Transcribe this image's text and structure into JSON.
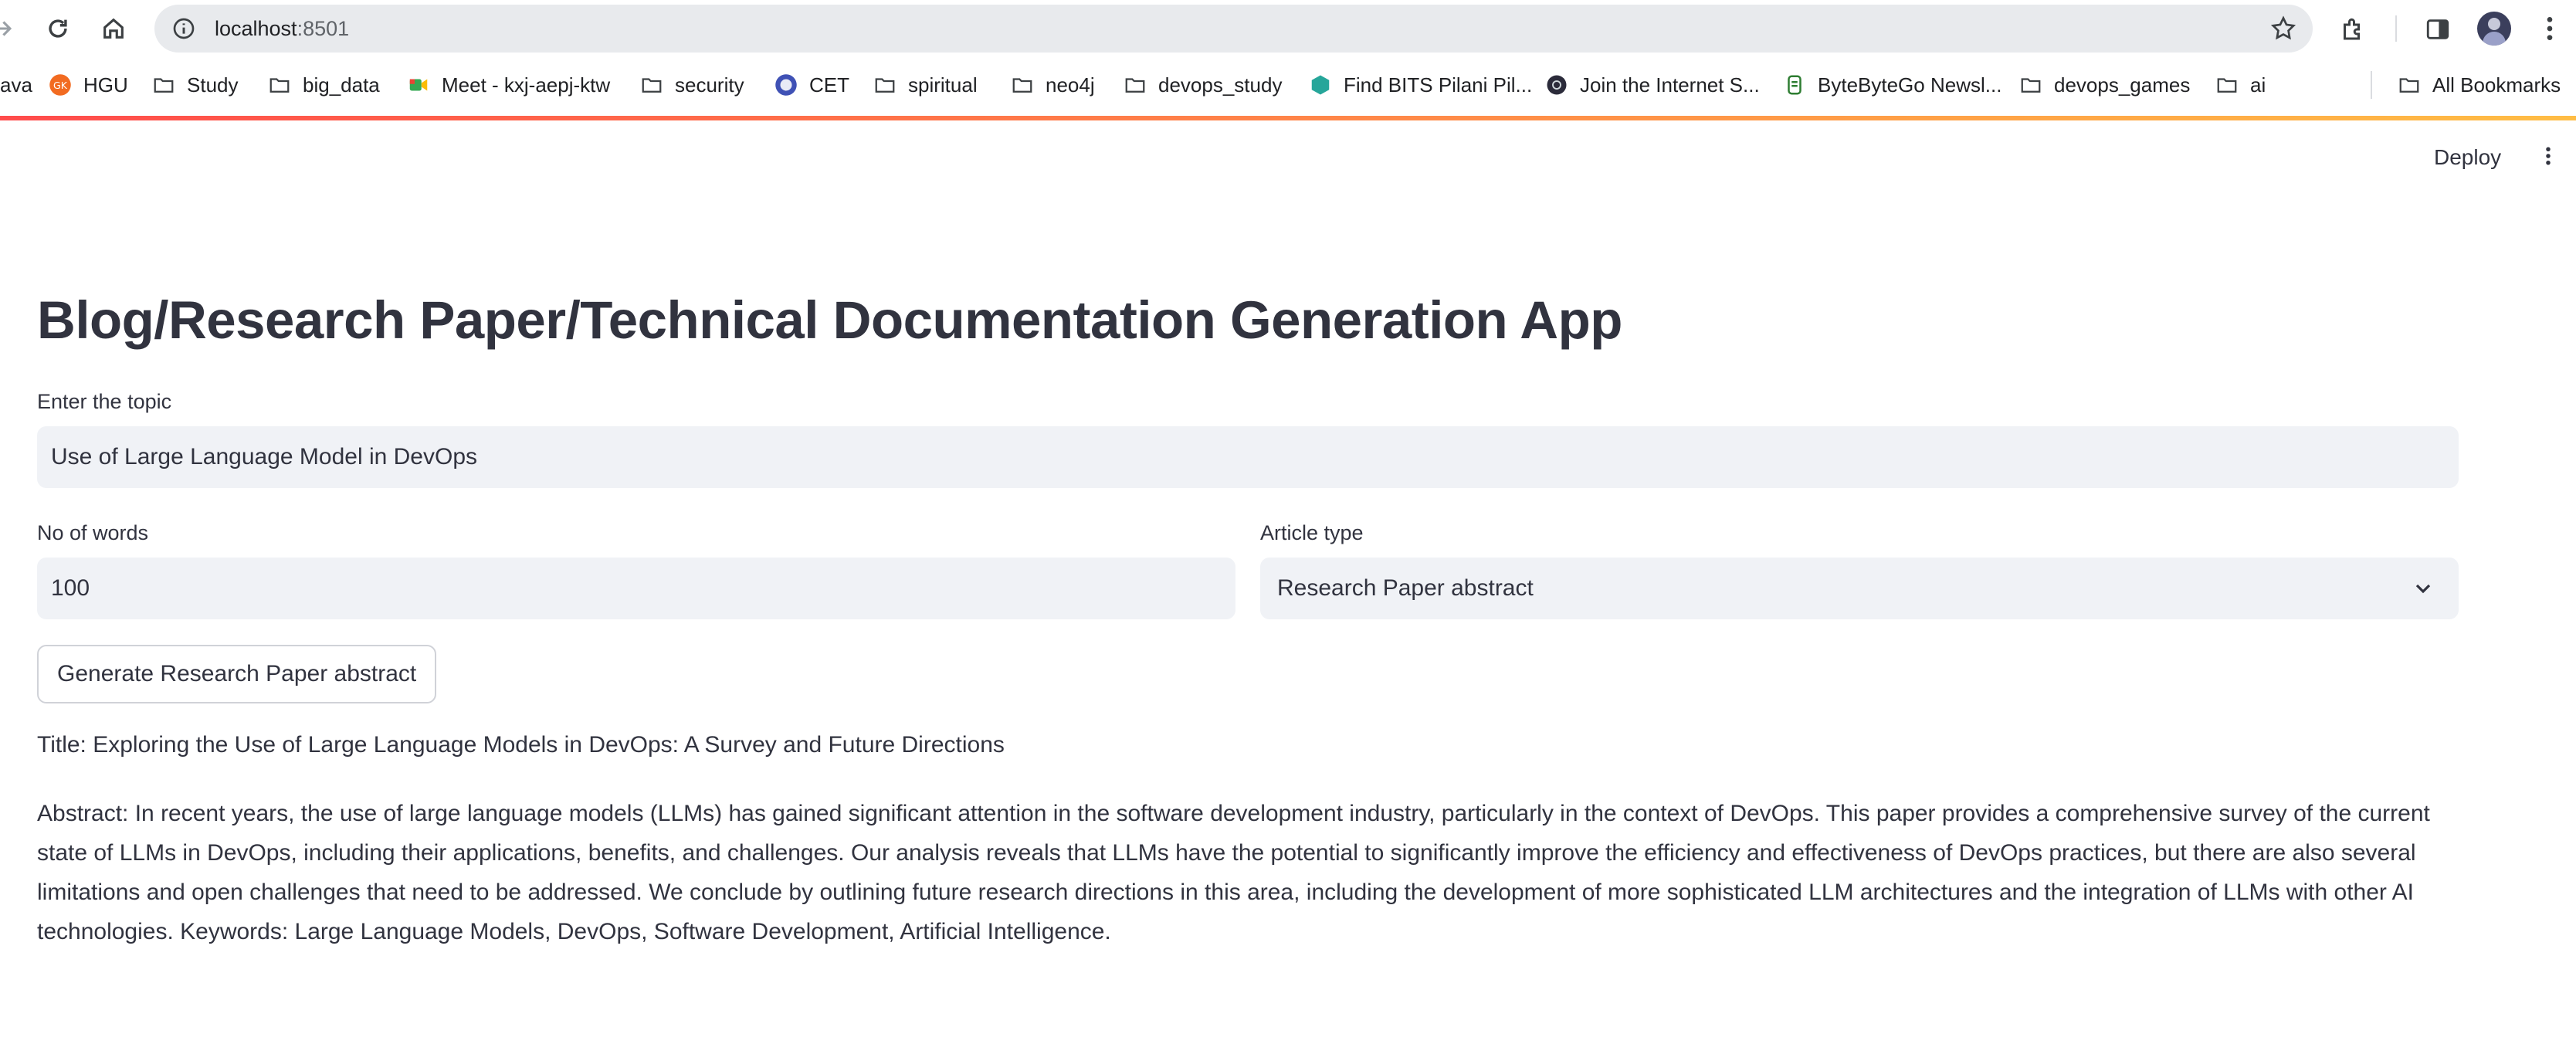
{
  "browser": {
    "url_host": "localhost",
    "url_port": ":8501",
    "bookmarks": [
      {
        "label": "ava",
        "icon": "site-icon"
      },
      {
        "label": "HGU",
        "icon": "hgu-icon"
      },
      {
        "label": "Study",
        "icon": "folder-icon"
      },
      {
        "label": "big_data",
        "icon": "folder-icon"
      },
      {
        "label": "Meet - kxj-aepj-ktw",
        "icon": "meet-icon"
      },
      {
        "label": "security",
        "icon": "folder-icon"
      },
      {
        "label": "CET",
        "icon": "cet-icon"
      },
      {
        "label": "spiritual",
        "icon": "folder-icon"
      },
      {
        "label": "neo4j",
        "icon": "folder-icon"
      },
      {
        "label": "devops_study",
        "icon": "folder-icon"
      },
      {
        "label": "Find BITS Pilani Pil...",
        "icon": "bits-icon"
      },
      {
        "label": "Join the Internet S...",
        "icon": "internet-icon"
      },
      {
        "label": "ByteByteGo Newsl...",
        "icon": "bytebytego-icon"
      },
      {
        "label": "devops_games",
        "icon": "folder-icon"
      },
      {
        "label": "ai",
        "icon": "folder-icon"
      }
    ],
    "all_bookmarks": "All Bookmarks"
  },
  "app": {
    "deploy_label": "Deploy",
    "title": "Blog/Research Paper/Technical Documentation Generation App",
    "topic": {
      "label": "Enter the topic",
      "value": "Use of Large Language Model in DevOps"
    },
    "words": {
      "label": "No of words",
      "value": "100"
    },
    "article_type": {
      "label": "Article type",
      "value": "Research Paper abstract"
    },
    "generate_button": "Generate Research Paper abstract",
    "output": {
      "title": "Title: Exploring the Use of Large Language Models in DevOps: A Survey and Future Directions",
      "abstract": "Abstract: In recent years, the use of large language models (LLMs) has gained significant attention in the software development industry, particularly in the context of DevOps. This paper provides a comprehensive survey of the current state of LLMs in DevOps, including their applications, benefits, and challenges. Our analysis reveals that LLMs have the potential to significantly improve the efficiency and effectiveness of DevOps practices, but there are also several limitations and open challenges that need to be addressed. We conclude by outlining future research directions in this area, including the development of more sophisticated LLM architectures and the integration of LLMs with other AI technologies. Keywords: Large Language Models, DevOps, Software Development, Artificial Intelligence."
    }
  },
  "colors": {
    "accent_start": "#ff4b4b",
    "accent_end": "#ffbd45",
    "input_bg": "#f0f2f6",
    "text": "#31333f"
  }
}
